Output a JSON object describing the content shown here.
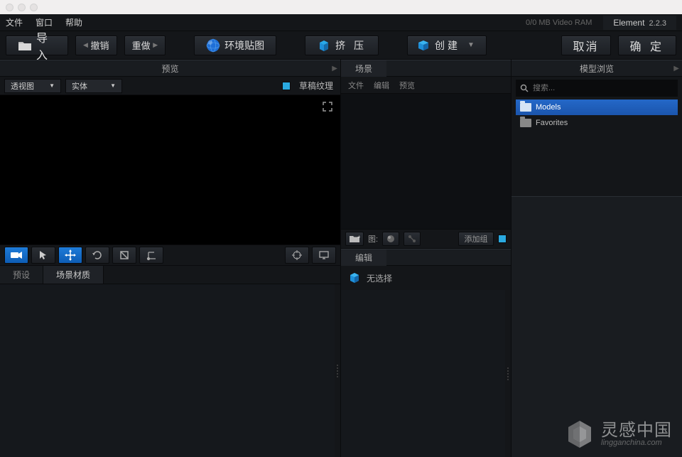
{
  "menu": {
    "file": "文件",
    "window": "窗口",
    "help": "帮助"
  },
  "status": {
    "vram": "0/0 MB Video RAM",
    "appname": "Element",
    "version": "2.2.3"
  },
  "toolbar": {
    "import": "导入",
    "undo": "撤销",
    "redo": "重做",
    "envmap": "环境贴图",
    "extrude": "挤 压",
    "create": "创建",
    "cancel": "取消",
    "ok": "确 定"
  },
  "preview": {
    "title": "预览",
    "viewmode": "透视图",
    "shading": "实体",
    "draft": "草稿纹理"
  },
  "bottom_tabs": {
    "presets": "预设",
    "scene_mat": "场景材质"
  },
  "scene": {
    "title": "场景",
    "file": "文件",
    "edit": "编辑",
    "preview": "预览",
    "tu": "图:",
    "addgroup": "添加组"
  },
  "editpanel": {
    "title": "编辑",
    "noselection": "无选择"
  },
  "browser": {
    "title": "模型浏览",
    "search_ph": "搜索...",
    "items": [
      {
        "label": "Models"
      },
      {
        "label": "Favorites"
      }
    ]
  },
  "watermark": {
    "cn": "灵感中国",
    "en": "lingganchina",
    "dom": ".com"
  }
}
